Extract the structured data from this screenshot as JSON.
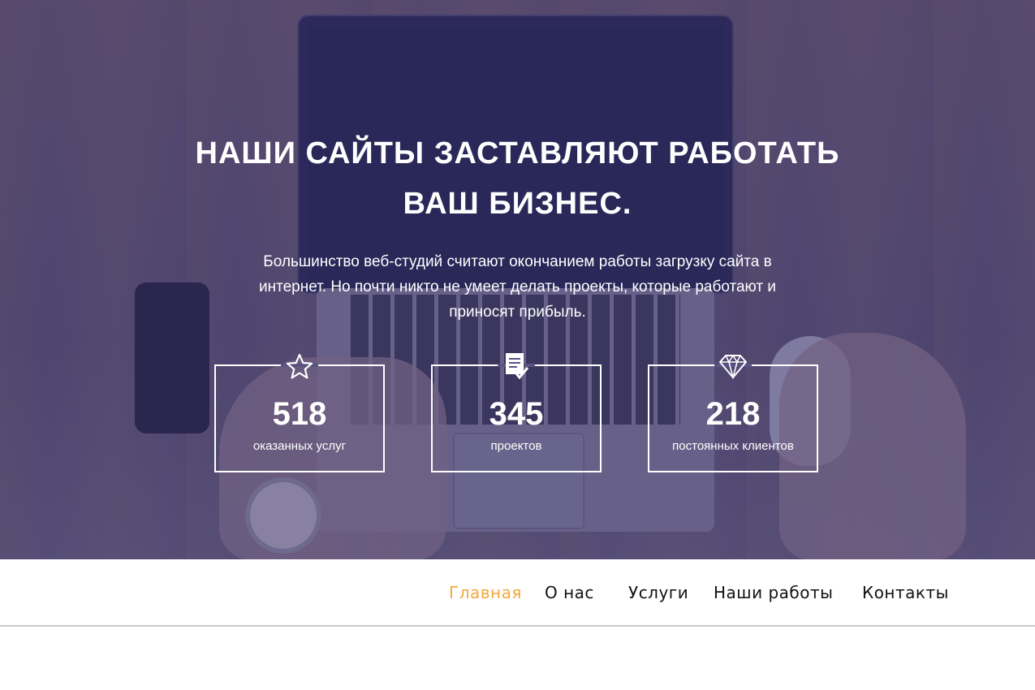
{
  "hero": {
    "title_line1": "НАШИ САЙТЫ ЗАСТАВЛЯЮТ РАБОТАТЬ",
    "title_line2": "ВАШ БИЗНЕС.",
    "subtitle": "Большинство веб-студий считают окончанием работы загрузку сайта в интернет. Но почти никто не умеет делать проекты, которые работают и приносят прибыль."
  },
  "stats": [
    {
      "icon": "star-icon",
      "value": "518",
      "label": "оказанных услуг"
    },
    {
      "icon": "document-check-icon",
      "value": "345",
      "label": "проектов"
    },
    {
      "icon": "diamond-icon",
      "value": "218",
      "label": "постоянных клиентов"
    }
  ],
  "nav": {
    "items": [
      {
        "label": "Главная",
        "active": true
      },
      {
        "label": "О нас",
        "active": false
      },
      {
        "label": "Услуги",
        "active": false
      },
      {
        "label": "Наши работы",
        "active": false
      },
      {
        "label": "Контакты",
        "active": false
      }
    ]
  },
  "colors": {
    "accent": "#f2a93b",
    "overlay": "#3a346e",
    "nav_text": "#111111"
  }
}
